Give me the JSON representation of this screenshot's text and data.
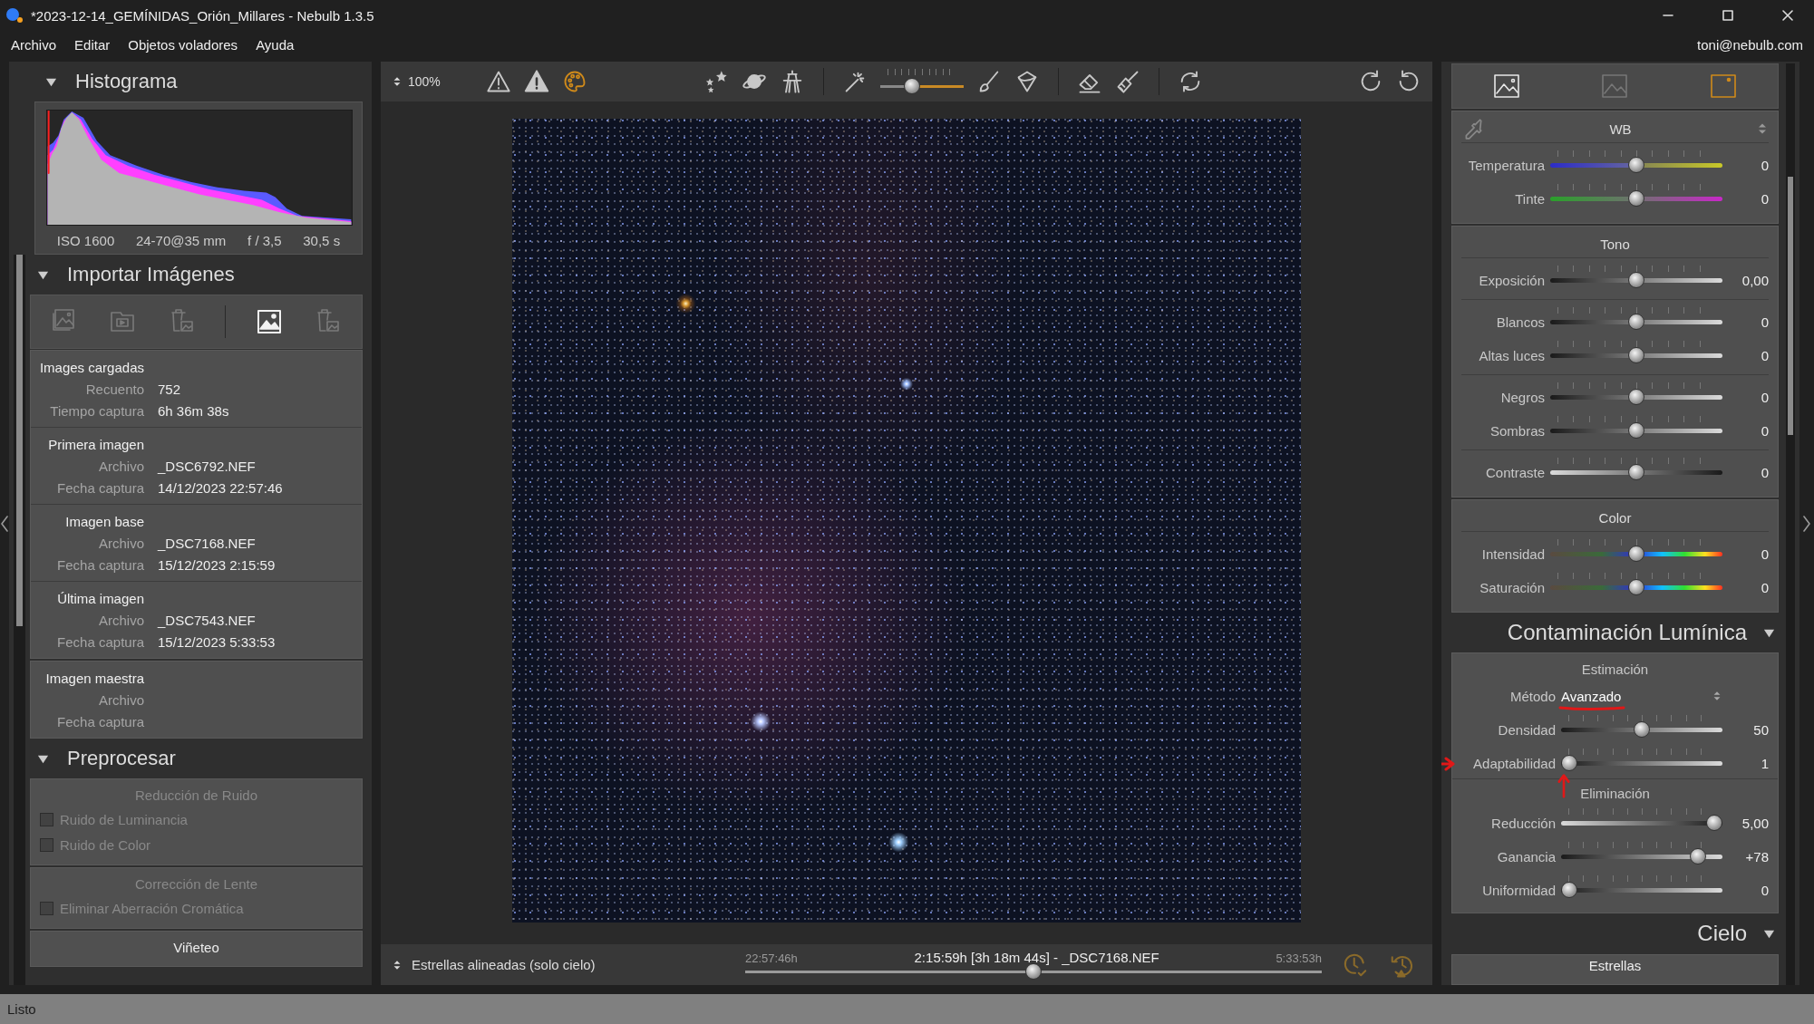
{
  "window": {
    "title": "*2023-12-14_GEMÍNIDAS_Orión_Millares - Nebulb 1.3.5"
  },
  "menu": [
    "Archivo",
    "Editar",
    "Objetos voladores",
    "Ayuda"
  ],
  "user": "toni@nebulb.com",
  "histogram": {
    "title": "Histograma",
    "expanded": true,
    "exif": [
      "ISO 1600",
      "24-70@35 mm",
      "f / 3,5",
      "30,5 s"
    ]
  },
  "import": {
    "title": "Importar Imágenes",
    "expanded": true,
    "tools": [
      {
        "selected": false
      },
      {
        "selected": false
      },
      {
        "selected": false
      },
      {
        "selected": true
      },
      {
        "selected": false
      }
    ],
    "groups": [
      {
        "title": "Images cargadas",
        "rows": [
          {
            "label": "Recuento",
            "value": "752"
          },
          {
            "label": "Tiempo captura",
            "value": "6h 36m 38s"
          }
        ]
      },
      {
        "title": "Primera imagen",
        "rows": [
          {
            "label": "Archivo",
            "value": "_DSC6792.NEF"
          },
          {
            "label": "Fecha captura",
            "value": "14/12/2023 22:57:46"
          }
        ]
      },
      {
        "title": "Imagen base",
        "rows": [
          {
            "label": "Archivo",
            "value": "_DSC7168.NEF"
          },
          {
            "label": "Fecha captura",
            "value": "15/12/2023 2:15:59"
          }
        ]
      },
      {
        "title": "Última imagen",
        "rows": [
          {
            "label": "Archivo",
            "value": "_DSC7543.NEF"
          },
          {
            "label": "Fecha captura",
            "value": "15/12/2023 5:33:53"
          }
        ]
      }
    ],
    "master": {
      "title": "Imagen maestra",
      "rows": [
        {
          "label": "Archivo"
        },
        {
          "label": "Fecha captura"
        }
      ]
    }
  },
  "preprocess": {
    "title": "Preprocesar",
    "expanded": true,
    "groups": [
      {
        "title": "Reducción de Ruido",
        "disabled": true,
        "options": [
          {
            "label": "Ruido de Luminancia",
            "checked": false,
            "disabled": true
          },
          {
            "label": "Ruido de Color",
            "checked": false,
            "disabled": true
          }
        ]
      },
      {
        "title": "Corrección de Lente",
        "disabled": true,
        "options": [
          {
            "label": "Eliminar Aberración Cromática",
            "checked": false,
            "disabled": true
          }
        ]
      },
      {
        "title": "Viñeteo",
        "disabled": false
      }
    ]
  },
  "toolbar": {
    "zoom": "100%",
    "tools": [
      {
        "selected": false
      },
      {
        "selected": false
      },
      {
        "selected": true
      },
      {
        "selected": false
      },
      {
        "selected": false
      },
      {
        "selected": false
      },
      {
        "selected": false
      },
      {
        "selected": false
      },
      {
        "selected": false
      },
      {
        "selected": false
      },
      {
        "selected": false
      },
      {
        "selected": false
      },
      {
        "selected": false
      },
      {
        "selected": false
      }
    ],
    "brush_size": {
      "level": 0.35
    }
  },
  "bottom_bar": {
    "mode": "Estrellas alineadas (solo cielo)",
    "start": "22:57:46h",
    "current": "2:15:59h [3h 18m 44s] - _DSC7168.NEF",
    "end": "5:33:53h",
    "level": 0.5
  },
  "right_panel": {
    "tabs": [
      {
        "selected": false,
        "disabled": false
      },
      {
        "selected": false,
        "disabled": true
      },
      {
        "selected": true,
        "disabled": false
      }
    ],
    "adjustments": [
      {
        "title": "WB",
        "kind": "wb",
        "blocks": [
          {
            "sliders": [
              {
                "label": "Temperatura",
                "value": "0",
                "level": 0.5,
                "kind": "temperature"
              },
              {
                "label": "Tinte",
                "value": "0",
                "level": 0.5,
                "kind": "tint"
              }
            ]
          }
        ]
      },
      {
        "title": "Tono",
        "kind": "plain",
        "blocks": [
          {
            "sliders": [
              {
                "label": "Exposición",
                "value": "0,00",
                "level": 0.5,
                "kind": "rising"
              }
            ]
          },
          {
            "sliders": [
              {
                "label": "Blancos",
                "value": "0",
                "level": 0.5,
                "kind": "rising"
              },
              {
                "label": "Altas luces",
                "value": "0",
                "level": 0.5,
                "kind": "rising"
              }
            ]
          },
          {
            "sliders": [
              {
                "label": "Negros",
                "value": "0",
                "level": 0.5,
                "kind": "rising"
              },
              {
                "label": "Sombras",
                "value": "0",
                "level": 0.5,
                "kind": "rising"
              }
            ]
          },
          {
            "sliders": [
              {
                "label": "Contraste",
                "value": "0",
                "level": 0.5,
                "kind": "falling"
              }
            ]
          }
        ]
      },
      {
        "title": "Color",
        "kind": "plain",
        "blocks": [
          {
            "sliders": [
              {
                "label": "Intensidad",
                "value": "0",
                "level": 0.5,
                "kind": "spectrum"
              },
              {
                "label": "Saturación",
                "value": "0",
                "level": 0.5,
                "kind": "spectrum"
              }
            ]
          }
        ]
      }
    ],
    "light_pollution": {
      "title": "Contaminación Lumínica",
      "expanded": true,
      "sections": [
        {
          "title": "Estimación",
          "method": {
            "label": "Método",
            "value": "Avanzado"
          },
          "sliders": [
            {
              "label": "Densidad",
              "value": "50",
              "level": 0.5,
              "kind": "rising"
            },
            {
              "label": "Adaptabilidad",
              "value": "1",
              "level": 0,
              "kind": "rising"
            }
          ]
        },
        {
          "title": "Eliminación",
          "sliders": [
            {
              "label": "Reducción",
              "value": "5,00",
              "level": 1,
              "kind": "falling"
            },
            {
              "label": "Ganancia",
              "value": "+78",
              "level": 0.89,
              "kind": "rising"
            },
            {
              "label": "Uniformidad",
              "value": "0",
              "level": 0,
              "kind": "rising"
            }
          ]
        }
      ]
    },
    "sky": {
      "title": "Cielo",
      "expanded": true,
      "group_title": "Estrellas"
    }
  },
  "status_bar": "Listo"
}
